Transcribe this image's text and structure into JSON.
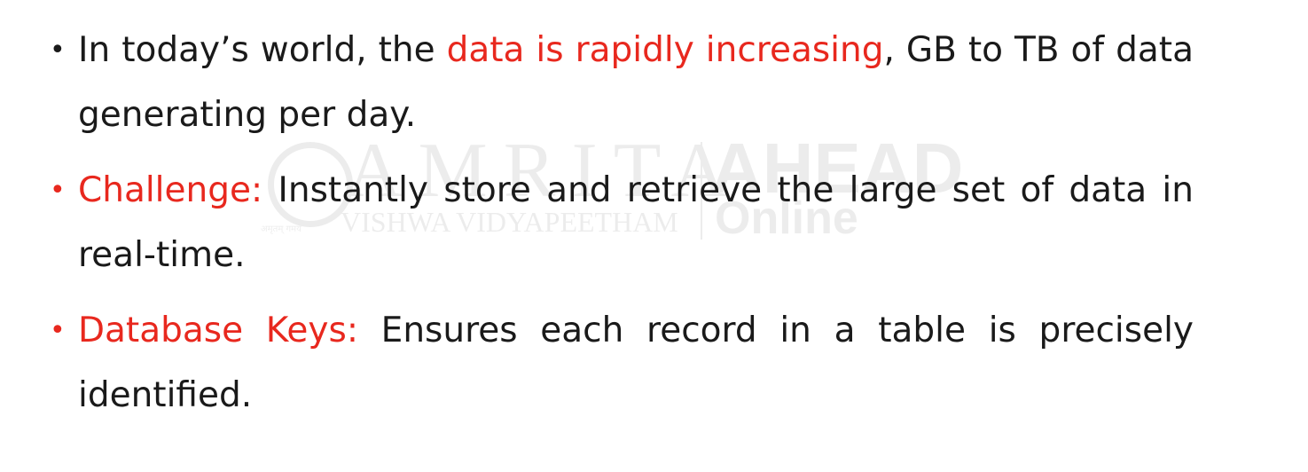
{
  "colors": {
    "text": "#1a1a1a",
    "accent": "#e8281e"
  },
  "watermark": {
    "main": "AMRITA",
    "sub": "VISHWA VIDYAPEETHAM",
    "right_top": "AHEAD",
    "right_bottom": "Online",
    "seal_text": "अमृतम् गमय"
  },
  "bullets": [
    {
      "before": "In today’s world, the ",
      "highlight": "data is rapidly increasing",
      "after": ", GB to TB of data generating per day."
    },
    {
      "before": "",
      "highlight": "Challenge:",
      "after": " Instantly store and retrieve the large set of data in real-time."
    },
    {
      "before": "",
      "highlight": "Database Keys:",
      "after": " Ensures each record in a table is precisely identified."
    }
  ]
}
